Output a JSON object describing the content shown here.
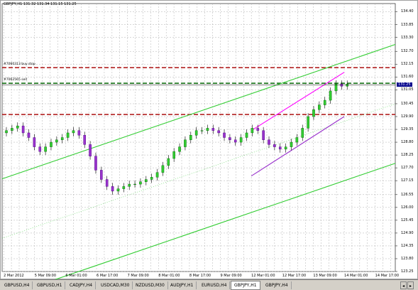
{
  "chart": {
    "title": "GBPJPY,H1  131.32 131.34 131.15 131.25",
    "current_price": "131.25",
    "orders": [
      {
        "label": "#7060313 buy stop",
        "price": 132.0,
        "color": "#b22222"
      },
      {
        "label": "#7062565 sell",
        "price": 131.33,
        "color": "#006400"
      },
      {
        "label": "",
        "price": 129.99,
        "color": "#b22222"
      }
    ],
    "chart_data": {
      "type": "candlestick",
      "symbol": "GBPJPY",
      "timeframe": "H1",
      "ylim": [
        123.25,
        134.75
      ],
      "price_ticks": [
        "134.40",
        "133.85",
        "133.30",
        "132.70",
        "132.15",
        "131.60",
        "131.05",
        "130.45",
        "129.90",
        "129.35",
        "128.80",
        "128.25",
        "127.70",
        "127.15",
        "126.55",
        "126.00",
        "125.45",
        "124.90",
        "124.35",
        "123.80",
        "123.25"
      ],
      "time_ticks": [
        "2 Mar 2012",
        "5 Mar 09:00",
        "6 Mar 01:00",
        "6 Mar 17:00",
        "7 Mar 09:00",
        "8 Mar 01:00",
        "8 Mar 17:00",
        "9 Mar 09:00",
        "12 Mar 01:00",
        "12 Mar 17:00",
        "13 Mar 09:00",
        "14 Mar 01:00",
        "14 Mar 17:00"
      ],
      "grid": true,
      "closes": [
        129.3,
        129.4,
        129.5,
        129.2,
        129.0,
        128.6,
        128.4,
        128.6,
        128.8,
        128.9,
        129.0,
        129.2,
        129.3,
        129.1,
        128.7,
        128.2,
        127.6,
        127.2,
        126.9,
        126.7,
        126.8,
        126.9,
        127.0,
        127.0,
        127.1,
        127.2,
        127.3,
        127.5,
        127.8,
        128.1,
        128.4,
        128.6,
        128.9,
        129.1,
        129.3,
        129.3,
        129.4,
        129.3,
        129.2,
        129.0,
        128.9,
        128.8,
        129.0,
        129.2,
        129.4,
        129.3,
        128.9,
        128.7,
        128.6,
        128.5,
        128.6,
        128.8,
        129.0,
        129.4,
        129.9,
        130.2,
        130.4,
        130.6,
        131.0,
        131.3,
        131.2,
        131.3
      ],
      "channels": [
        {
          "name": "",
          "color": "#32cd32",
          "points": [
            [
              "2 Mar 2012",
              127.25
            ],
            [
              "14 Mar 17:00",
              132.7
            ]
          ],
          "offsets": [
            0,
            -5.1
          ]
        },
        {
          "name": "",
          "color": "#ff00ff",
          "points": [
            [
              "12 Mar 01:00",
              129.3
            ],
            [
              "14 Mar 01:00",
              131.8
            ]
          ]
        },
        {
          "name": "",
          "color": "#9932cc",
          "points": [
            [
              "12 Mar 01:00",
              127.35
            ],
            [
              "14 Mar 01:00",
              129.9
            ]
          ]
        }
      ]
    }
  },
  "tabs": [
    "GBPUSD,H4",
    "GBPUSD,H1",
    "CADJPY,H4",
    "USDCAD,M30",
    "NZDUSD,M30",
    "AUDJPY,H1",
    "EURUSD,H4",
    "GBPJPY,H1",
    "GBPJPY,H4"
  ],
  "active_tab": "GBPJPY,H1"
}
